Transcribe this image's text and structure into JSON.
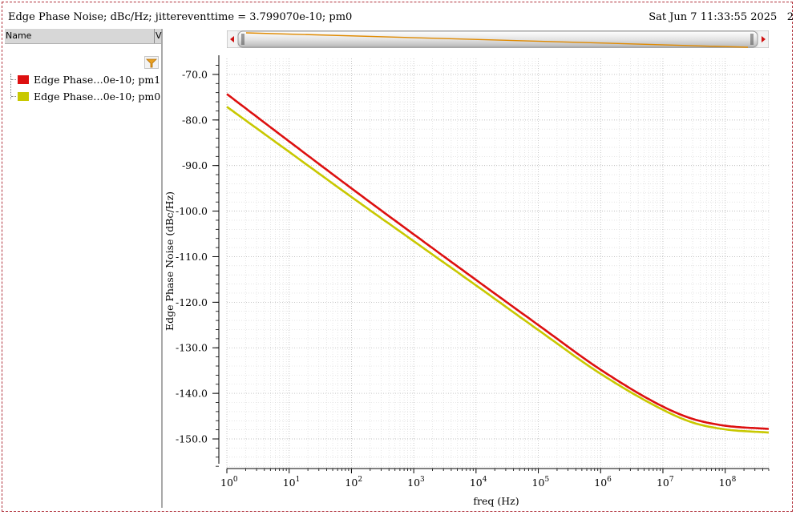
{
  "window": {
    "title": "Edge Phase Noise; dBc/Hz; jittereventtime = 3.799070e-10; pm0",
    "timestamp": "Sat Jun 7 11:33:55 2025",
    "timestamp_suffix": "2"
  },
  "legend": {
    "header_name": "Name",
    "header_v": "V",
    "items": [
      {
        "label": "Edge Phase…0e-10; pm1",
        "color": "#dd1010"
      },
      {
        "label": "Edge Phase…0e-10; pm0",
        "color": "#c8c800"
      }
    ]
  },
  "icons": {
    "filter": "filter-funnel-icon",
    "scroll_left": "arrow-left-icon",
    "scroll_right": "arrow-right-icon"
  },
  "chart_data": {
    "type": "line",
    "title": "",
    "xlabel": "freq (Hz)",
    "ylabel": "Edge Phase Noise (dBc/Hz)",
    "x_scale": "log",
    "xlim": [
      1,
      500000000
    ],
    "ylim": [
      -156.5,
      -66.5
    ],
    "yticks": [
      -70,
      -80,
      -90,
      -100,
      -110,
      -120,
      -130,
      -140,
      -150
    ],
    "ytick_labels": [
      "-70.0",
      "-80.0",
      "-90.0",
      "-100.0",
      "-110.0",
      "-120.0",
      "-130.0",
      "-140.0",
      "-150.0"
    ],
    "xticks": [
      1,
      10,
      100,
      1000,
      10000,
      100000,
      1000000,
      10000000,
      100000000
    ],
    "xtick_labels": [
      {
        "base": "10",
        "exp": "0"
      },
      {
        "base": "10",
        "exp": "1"
      },
      {
        "base": "10",
        "exp": "2"
      },
      {
        "base": "10",
        "exp": "3"
      },
      {
        "base": "10",
        "exp": "4"
      },
      {
        "base": "10",
        "exp": "5"
      },
      {
        "base": "10",
        "exp": "6"
      },
      {
        "base": "10",
        "exp": "7"
      },
      {
        "base": "10",
        "exp": "8"
      }
    ],
    "grid": true,
    "series": [
      {
        "name": "Edge Phase…0e-10; pm1",
        "color": "#dd1010",
        "x": [
          1,
          10,
          100,
          1000,
          10000,
          100000,
          1000000,
          10000000,
          30000000,
          100000000,
          500000000
        ],
        "y": [
          -74.3,
          -84.7,
          -95.0,
          -105.1,
          -115.1,
          -125.0,
          -134.8,
          -142.9,
          -145.6,
          -147.1,
          -147.8
        ]
      },
      {
        "name": "Edge Phase…0e-10; pm0",
        "color": "#c8c800",
        "x": [
          1,
          10,
          100,
          1000,
          10000,
          100000,
          1000000,
          10000000,
          30000000,
          100000000,
          500000000
        ],
        "y": [
          -77.1,
          -87.0,
          -96.9,
          -106.6,
          -116.3,
          -126.1,
          -135.7,
          -143.6,
          -146.4,
          -147.9,
          -148.6
        ]
      }
    ]
  }
}
